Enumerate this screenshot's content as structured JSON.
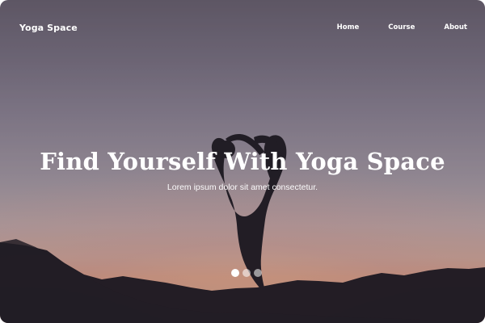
{
  "navbar": {
    "brand": "Yoga Space",
    "links": [
      {
        "label": "Home"
      },
      {
        "label": "Course"
      },
      {
        "label": "About"
      }
    ]
  },
  "hero": {
    "title": "Find Yourself With Yoga Space",
    "subtitle": "Lorem ipsum dolor sit amet consectetur."
  },
  "carousel": {
    "slides": 3,
    "active_index": 0
  },
  "colors": {
    "text": "#ffffff",
    "dot_inactive": "rgba(255,255,255,0.55)",
    "sky_top": "#6c6373",
    "sunset": "#e0a68c"
  },
  "icons": {
    "dot": "carousel-dot"
  }
}
